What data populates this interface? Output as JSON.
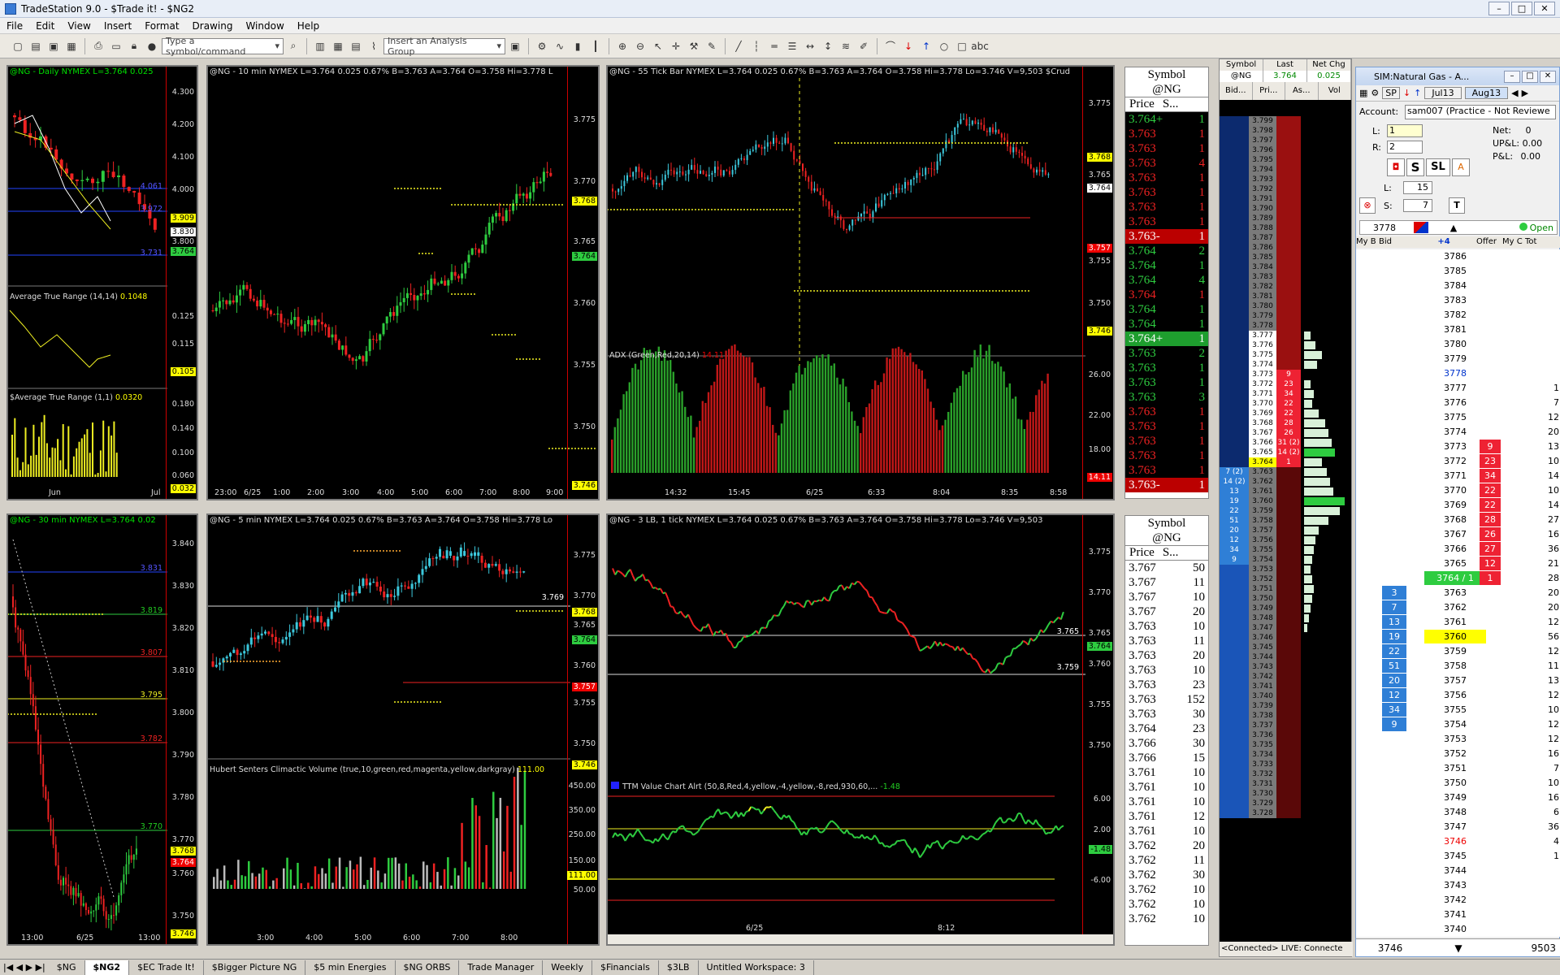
{
  "window": {
    "title": "TradeStation 9.0 - $Trade it! - $NG2"
  },
  "menu": [
    "File",
    "Edit",
    "View",
    "Insert",
    "Format",
    "Drawing",
    "Window",
    "Help"
  ],
  "toolbar": {
    "symbol_placeholder": "Type a symbol/command",
    "analysis_placeholder": "Insert an Analysis Group"
  },
  "charts": {
    "c1": {
      "hdr": "@NG - Daily  NYMEX  L=3.764  0.025",
      "y": [
        "4.300",
        "4.200",
        "4.100",
        "4.000",
        "3.900",
        "3.800"
      ],
      "tags": [
        "4.061",
        "3.972",
        "3.909",
        "3.830",
        "3.800",
        "3.764",
        "3.731"
      ],
      "sub1": "Average True Range (14,14)",
      "sub1v": "0.1048",
      "sub1y": [
        "0.125",
        "0.115",
        "0.105"
      ],
      "sub2": "$Average True Range (1,1)",
      "sub2v": "0.0320",
      "sub2y": [
        "0.180",
        "0.140",
        "0.100",
        "0.060",
        "0.032"
      ],
      "x": [
        "Jun",
        "Jul"
      ]
    },
    "c2": {
      "hdr": "@NG - 10 min  NYMEX  L=3.764  0.025  0.67%  B=3.763  A=3.764  O=3.758  Hi=3.778  L",
      "y": [
        "3.775",
        "3.770",
        "3.765",
        "3.760",
        "3.755",
        "3.750"
      ],
      "tags": [
        "3.768",
        "3.764",
        "3.746"
      ],
      "x": [
        "23:00",
        "6/25",
        "1:00",
        "2:00",
        "3:00",
        "4:00",
        "5:00",
        "6:00",
        "7:00",
        "8:00",
        "9:00"
      ]
    },
    "c3": {
      "hdr": "@NG - 55 Tick Bar  NYMEX  L=3.764  0.025  0.67%  B=3.763  A=3.764  O=3.758  Hi=3.778  Lo=3.746  V=9,503  $Crud",
      "y": [
        "3.775",
        "3.770",
        "3.765",
        "3.760",
        "3.755",
        "3.750"
      ],
      "tags": [
        "3.768",
        "3.764",
        "3.757",
        "3.746"
      ],
      "sub": "ADX (Green,Red,20,14)",
      "subv": "14.11",
      "suby": [
        "26.00",
        "22.00",
        "18.00"
      ],
      "subtag": "14.11",
      "x": [
        "14:32",
        "15:45",
        "6/25",
        "6:33",
        "8:04",
        "8:35",
        "8:58"
      ]
    },
    "c4": {
      "hdr": "@NG - 30 min  NYMEX  L=3.764  0.02",
      "y": [
        "3.840",
        "3.830",
        "3.820",
        "3.810",
        "3.800",
        "3.790",
        "3.780",
        "3.770",
        "3.760",
        "3.750"
      ],
      "tags": [
        "3.831",
        "3.819",
        "3.807",
        "3.795",
        "3.782",
        "3.770",
        "3.768",
        "3.764",
        "3.746"
      ],
      "x": [
        "13:00",
        "6/25",
        "13:00"
      ]
    },
    "c5": {
      "hdr": "@NG - 5 min  NYMEX  L=3.764  0.025  0.67%  B=3.763  A=3.764  O=3.758  Hi=3.778  Lo",
      "y": [
        "3.775",
        "3.770",
        "3.765",
        "3.760",
        "3.755",
        "3.750"
      ],
      "tags": [
        "3.769",
        "3.768",
        "3.764",
        "3.757",
        "3.746"
      ],
      "sub": "Hubert Senters Climactic Volume (true,10,green,red,magenta,yellow,darkgray)",
      "subv": "111.00",
      "suby": [
        "450.00",
        "350.00",
        "250.00",
        "150.00",
        "111.00",
        "50.00"
      ],
      "x": [
        "3:00",
        "4:00",
        "5:00",
        "6:00",
        "7:00",
        "8:00"
      ]
    },
    "c6": {
      "hdr": "@NG - 3 LB, 1 tick  NYMEX  L=3.764  0.025  0.67%  B=3.763  A=3.764  O=3.758  Hi=3.778  Lo=3.746  V=9,503",
      "y": [
        "3.775",
        "3.770",
        "3.765",
        "3.760",
        "3.755",
        "3.750"
      ],
      "tags": [
        "3.765",
        "3.764",
        "3.759"
      ],
      "sub": "TTM Value Chart Alrt (50,8,Red,4,yellow,-4,yellow,-8,red,930,60,...",
      "subv": "-1.48",
      "suby": [
        "6.00",
        "2.00",
        "-6.00"
      ],
      "subtag": "-1.48",
      "x": [
        "6/25",
        "8:12"
      ]
    }
  },
  "tsr1": {
    "sym_lbl": "Symbol",
    "sym": "@NG",
    "col1": "Price",
    "col2": "S...",
    "rows": [
      [
        "3.764+",
        "1",
        "g"
      ],
      [
        "3.763",
        "1",
        "r"
      ],
      [
        "3.763",
        "1",
        "r"
      ],
      [
        "3.763",
        "4",
        "r"
      ],
      [
        "3.763",
        "1",
        "r"
      ],
      [
        "3.763",
        "1",
        "r"
      ],
      [
        "3.763",
        "1",
        "r"
      ],
      [
        "3.763",
        "1",
        "r"
      ],
      [
        "3.763-",
        "1",
        "rb"
      ],
      [
        "3.764",
        "2",
        "g"
      ],
      [
        "3.764",
        "1",
        "g"
      ],
      [
        "3.764",
        "4",
        "g"
      ],
      [
        "3.764",
        "1",
        "r"
      ],
      [
        "3.764",
        "1",
        "g"
      ],
      [
        "3.764",
        "1",
        "g"
      ],
      [
        "3.764+",
        "1",
        "gb"
      ],
      [
        "3.763",
        "2",
        "g"
      ],
      [
        "3.763",
        "1",
        "g"
      ],
      [
        "3.763",
        "1",
        "g"
      ],
      [
        "3.763",
        "3",
        "g"
      ],
      [
        "3.763",
        "1",
        "r"
      ],
      [
        "3.763",
        "1",
        "r"
      ],
      [
        "3.763",
        "1",
        "r"
      ],
      [
        "3.763",
        "1",
        "r"
      ],
      [
        "3.763",
        "1",
        "r"
      ],
      [
        "3.763-",
        "1",
        "rb"
      ]
    ]
  },
  "tsr2": {
    "sym_lbl": "Symbol",
    "sym": "@NG",
    "col1": "Price",
    "col2": "S...",
    "rows": [
      [
        "3.767",
        "50"
      ],
      [
        "3.767",
        "11"
      ],
      [
        "3.767",
        "10"
      ],
      [
        "3.767",
        "20"
      ],
      [
        "3.763",
        "10"
      ],
      [
        "3.763",
        "11"
      ],
      [
        "3.763",
        "20"
      ],
      [
        "3.763",
        "10"
      ],
      [
        "3.763",
        "23"
      ],
      [
        "3.763",
        "152"
      ],
      [
        "3.763",
        "30"
      ],
      [
        "3.764",
        "23"
      ],
      [
        "3.766",
        "30"
      ],
      [
        "3.766",
        "15"
      ],
      [
        "3.761",
        "10"
      ],
      [
        "3.761",
        "10"
      ],
      [
        "3.761",
        "10"
      ],
      [
        "3.761",
        "12"
      ],
      [
        "3.761",
        "10"
      ],
      [
        "3.762",
        "20"
      ],
      [
        "3.762",
        "11"
      ],
      [
        "3.762",
        "30"
      ],
      [
        "3.762",
        "10"
      ],
      [
        "3.762",
        "10"
      ],
      [
        "3.762",
        "10"
      ]
    ]
  },
  "dom": {
    "cols": [
      "Symbol",
      "Last",
      "Net Chg"
    ],
    "sym": "@NG",
    "last": "3.764",
    "chg": "0.025",
    "sub": [
      "Bid...",
      "Pri...",
      "As...",
      "Vol Bars"
    ],
    "footer": "<Connected>  LIVE: Connecte"
  },
  "trade": {
    "title": "SIM:Natural Gas - A...",
    "sp": "SP",
    "m1": "Jul13",
    "m2": "Aug13",
    "account_lbl": "Account:",
    "account": "sam007 (Practice - Not Reviewe",
    "L_lbl": "L:",
    "L": "1",
    "R_lbl": "R:",
    "R": "2",
    "net_lbl": "Net:",
    "net": "0",
    "upl_lbl": "UP&L:",
    "upl": "0.00",
    "pl_lbl": "P&L:",
    "pl": "0.00",
    "Lq_lbl": "L:",
    "Lq": "15",
    "S_lbl": "S:",
    "S": "7",
    "qty": "3778",
    "plus": "+4",
    "open": "Open",
    "hdr": [
      "My B",
      "Bid",
      "Offer",
      "My C",
      "Tot"
    ],
    "foot_price": "3746",
    "foot_vol": "9503",
    "last_row": "3764 / 1"
  },
  "tabs": [
    "$NG",
    "$NG2",
    "$EC Trade It!",
    "$Bigger Picture NG",
    "$5 min Energies",
    "$NG ORBS",
    "Trade Manager",
    "Weekly",
    "$Financials",
    "$3LB",
    "Untitled Workspace:  3"
  ]
}
